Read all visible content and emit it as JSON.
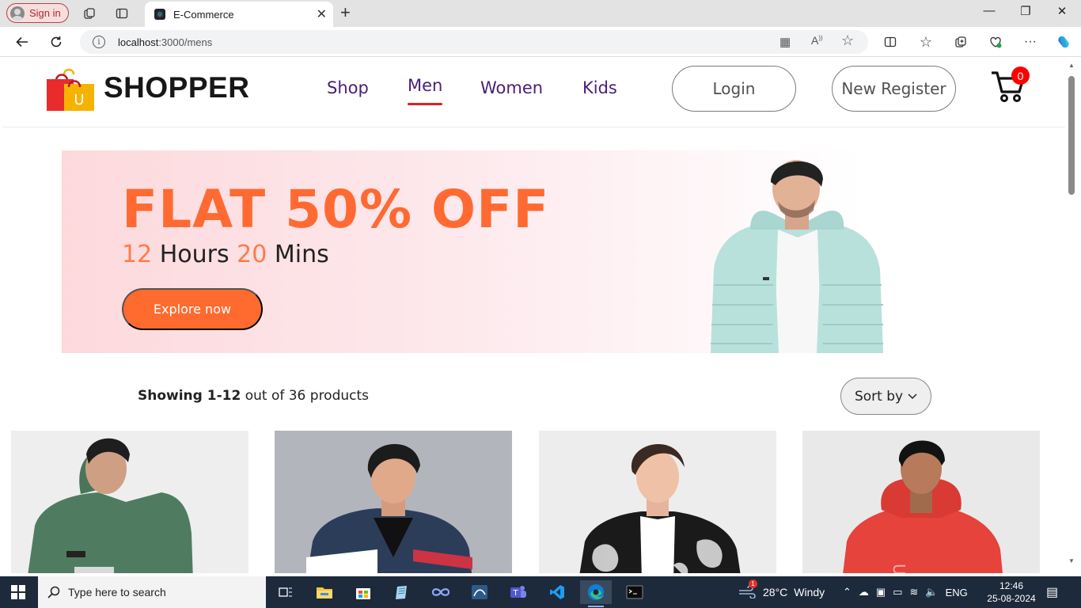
{
  "browser": {
    "signin_label": "Sign in",
    "tab_title": "E-Commerce",
    "url_host": "localhost",
    "url_path": ":3000/mens"
  },
  "nav": {
    "brand": "SHOPPER",
    "logo_letter": "U",
    "links": [
      {
        "label": "Shop"
      },
      {
        "label": "Men"
      },
      {
        "label": "Women"
      },
      {
        "label": "Kids"
      }
    ],
    "login_label": "Login",
    "register_label": "New Register",
    "cart_count": "0"
  },
  "banner": {
    "headline": "FLAT 50% OFF",
    "hours_num": "12",
    "hours_label": "Hours",
    "mins_num": "20",
    "mins_label": "Mins",
    "cta_label": "Explore now"
  },
  "listing": {
    "showing_range": "Showing 1-12",
    "showing_rest": "out of 36 products",
    "sort_label": "Sort by"
  },
  "taskbar": {
    "search_placeholder": "Type here to search",
    "temperature": "28°C",
    "weather_text": "Windy",
    "weather_badge": "1",
    "language": "ENG",
    "time": "12:46",
    "date": "25-08-2024"
  },
  "colors": {
    "accent_orange": "#ff6a32",
    "nav_purple": "#4b1d79",
    "active_underline": "#e21d1d",
    "cart_badge": "#ff0000"
  },
  "icons": [
    "back-icon",
    "refresh-icon",
    "info-icon",
    "star-icon",
    "cart-icon",
    "windows-icon",
    "search-icon"
  ]
}
